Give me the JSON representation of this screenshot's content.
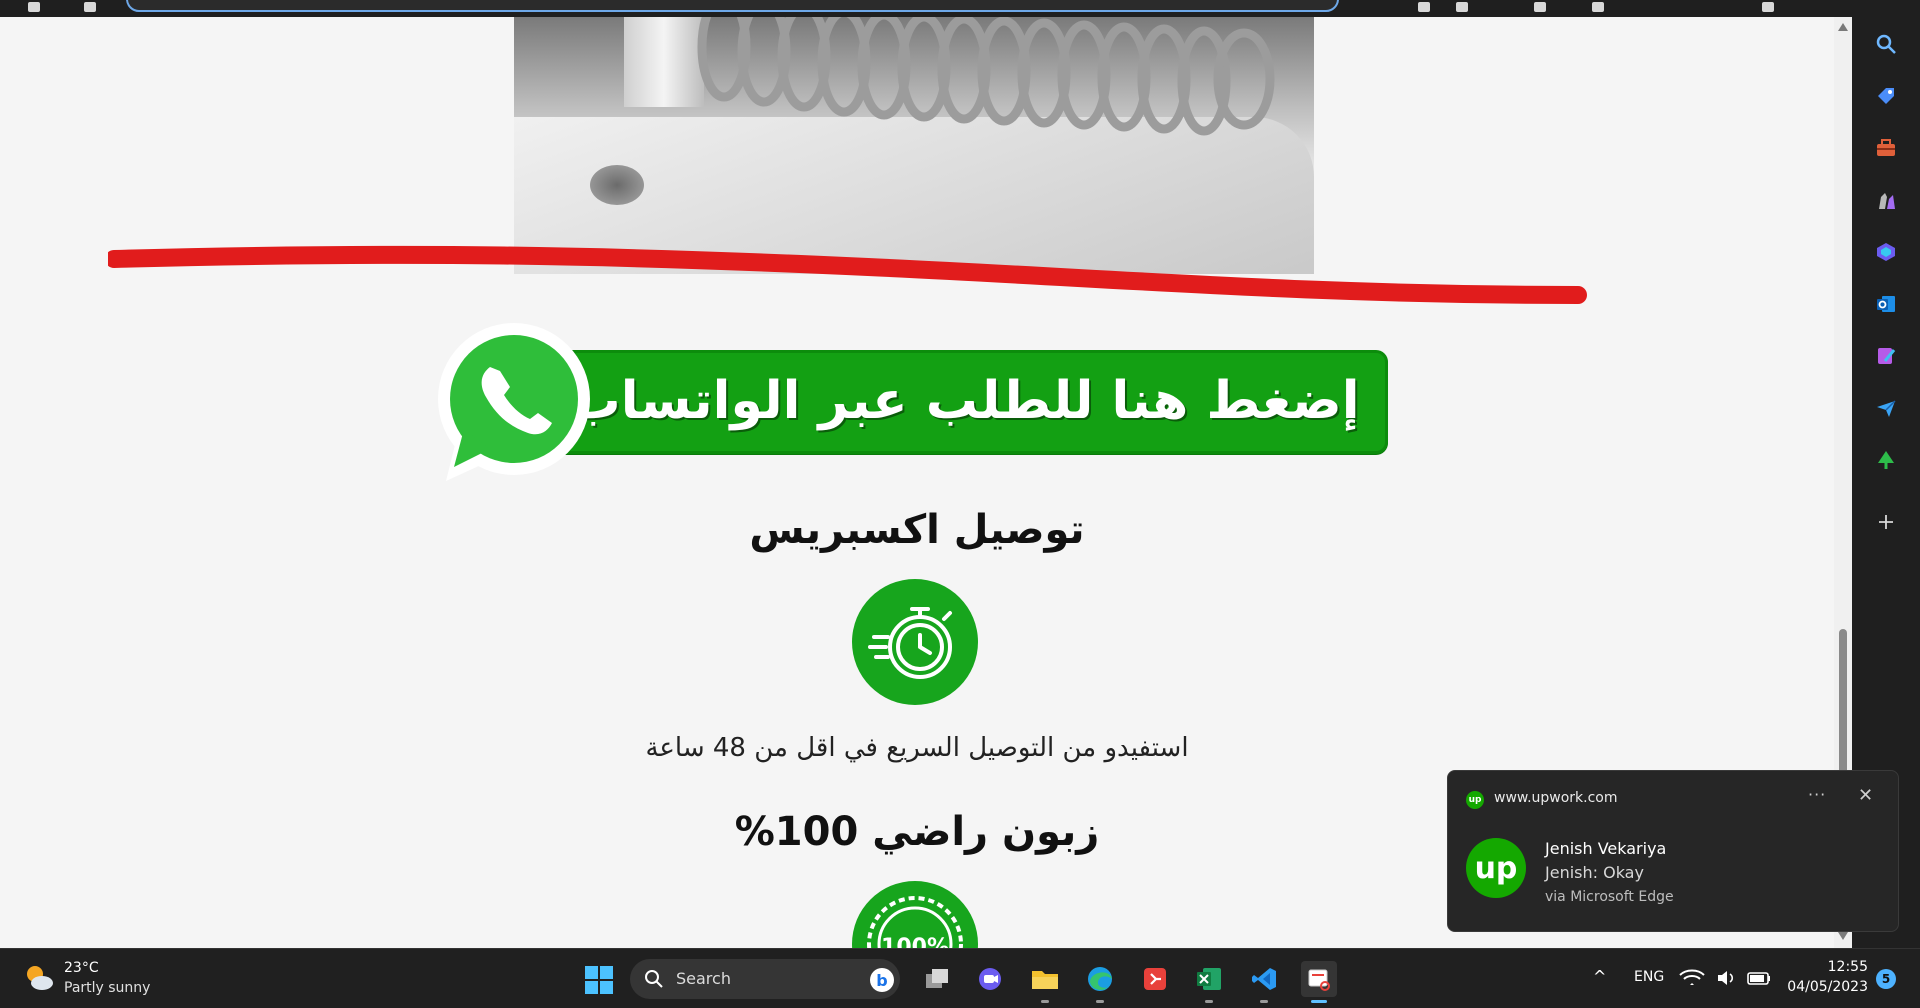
{
  "whatsapp_banner": {
    "text": "إضغط هنا للطلب عبر الواتساب"
  },
  "features": [
    {
      "title": "توصيل اكسبريس",
      "text": "استفيدو من التوصيل السريع  في اقل من 48 ساعة",
      "icon": "stopwatch-icon"
    },
    {
      "title": "زبون راضي 100%",
      "badge": "100%",
      "icon": "satisfaction-badge-icon"
    }
  ],
  "toast": {
    "source": "www.upwork.com",
    "more": "···",
    "close": "✕",
    "avatar_text": "up",
    "sender": "Jenish Vekariya",
    "message": "Jenish: Okay",
    "via": "via Microsoft Edge"
  },
  "taskbar": {
    "weather": {
      "temp": "23°C",
      "condition": "Partly sunny"
    },
    "search_label": "Search",
    "tray": {
      "chevron": "^",
      "language": "ENG"
    },
    "clock": {
      "time": "12:55",
      "date": "04/05/2023"
    },
    "notification_count": "5",
    "apps": [
      "task-view",
      "teams",
      "file-explorer",
      "edge",
      "git-client",
      "excel",
      "vscode",
      "snipping-tool"
    ]
  },
  "sidebar": {
    "icons": [
      "search-icon",
      "tag-icon",
      "toolbox-icon",
      "games-icon",
      "copilot-icon",
      "outlook-icon",
      "designer-icon",
      "send-icon",
      "tree-icon",
      "add-icon"
    ]
  },
  "colors": {
    "whatsapp_green": "#13a013",
    "feature_green": "#17a51d",
    "annotation_red": "#e11c1c",
    "upwork_green": "#14a800"
  }
}
